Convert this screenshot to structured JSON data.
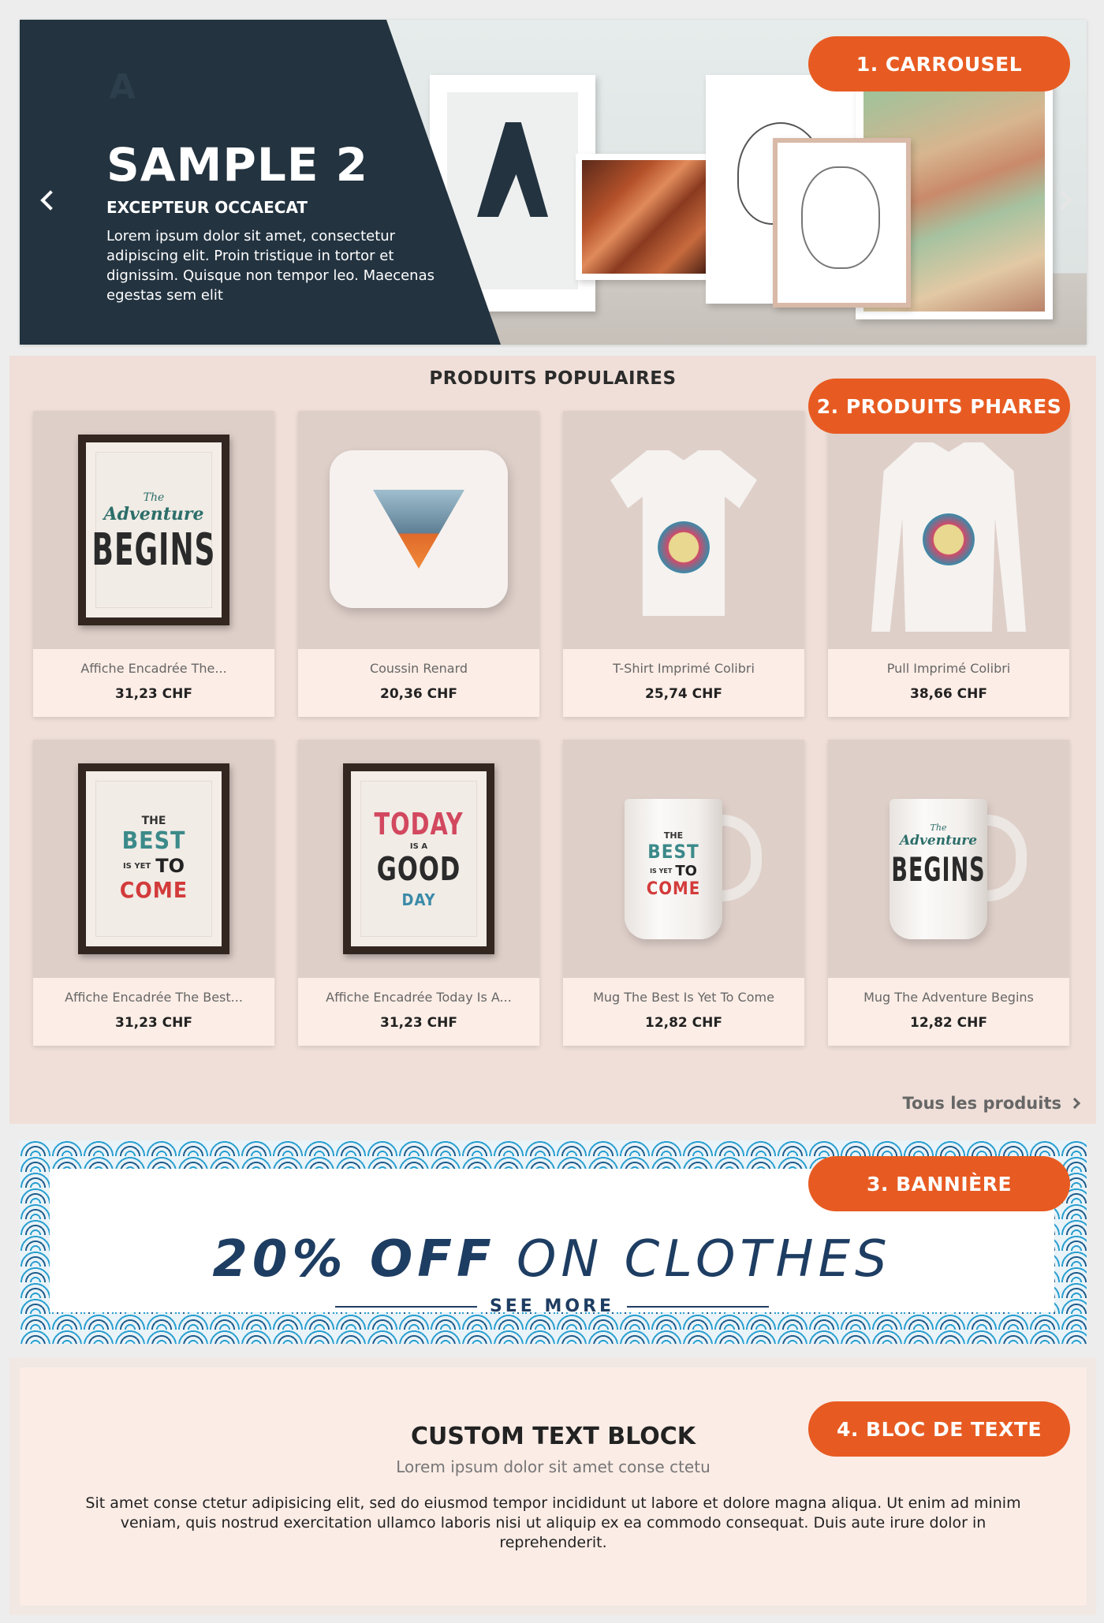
{
  "carousel": {
    "logo": "A",
    "title": "SAMPLE 2",
    "subtitle": "EXCEPTEUR OCCAECAT",
    "description": "Lorem ipsum dolor sit amet, consectetur adipiscing elit. Proin tristique in tortor et dignissim. Quisque non tempor leo. Maecenas egestas sem elit",
    "tag": "1. CARROUSEL"
  },
  "products": {
    "title": "PRODUITS POPULAIRES",
    "tag": "2. PRODUITS PHARES",
    "all_link": "Tous les produits",
    "items": [
      {
        "name": "Affiche Encadrée The...",
        "price": "31,23 CHF"
      },
      {
        "name": "Coussin Renard",
        "price": "20,36 CHF"
      },
      {
        "name": "T-Shirt Imprimé Colibri",
        "price": "25,74 CHF"
      },
      {
        "name": "Pull Imprimé Colibri",
        "price": "38,66 CHF"
      },
      {
        "name": "Affiche Encadrée The Best...",
        "price": "31,23 CHF"
      },
      {
        "name": "Affiche Encadrée Today Is A...",
        "price": "31,23 CHF"
      },
      {
        "name": "Mug The Best Is Yet To Come",
        "price": "12,82 CHF"
      },
      {
        "name": "Mug The Adventure Begins",
        "price": "12,82 CHF"
      }
    ],
    "art": {
      "adventure_the": "The",
      "adventure": "Adventure",
      "begins": "BEGINS",
      "best_the": "THE",
      "best": "BEST",
      "best_isyet": "IS YET",
      "best_to": "TO",
      "best_come": "COME",
      "today": "TODAY",
      "today_isa": "IS A",
      "today_good": "GOOD",
      "today_day": "DAY"
    }
  },
  "banner": {
    "headline_bold": "20% OFF",
    "headline_rest": " ON CLOTHES",
    "see_more": "SEE MORE",
    "tag": "3. BANNIÈRE"
  },
  "textblock": {
    "title": "CUSTOM TEXT BLOCK",
    "subtitle": "Lorem ipsum dolor sit amet conse ctetu",
    "body": "Sit amet conse ctetur adipisicing elit, sed do eiusmod tempor incididunt ut labore et dolore magna aliqua. Ut enim ad minim veniam, quis nostrud exercitation ullamco laboris nisi ut aliquip ex ea commodo consequat. Duis aute irure dolor in reprehenderit.",
    "tag": "4. BLOC DE TEXTE"
  },
  "colors": {
    "accent": "#e75b22",
    "dark_panel": "#233340",
    "banner_text": "#1e3d62",
    "products_bg": "#efdfd8"
  }
}
